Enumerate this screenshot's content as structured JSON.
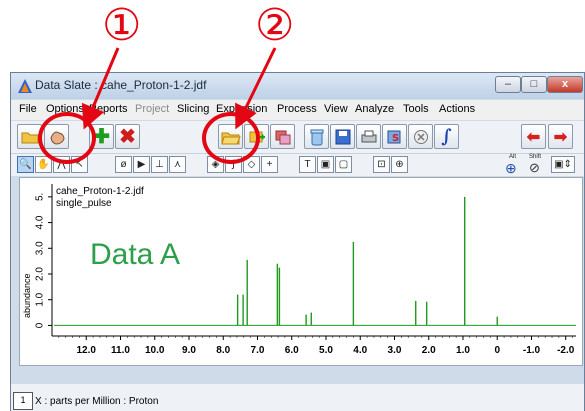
{
  "callouts": [
    {
      "num": "①"
    },
    {
      "num": "②"
    }
  ],
  "window": {
    "title": "Data Slate : cahe_Proton-1-2.jdf",
    "close_glyph": "x",
    "min_glyph": "–",
    "max_glyph": "□"
  },
  "menu": [
    "File",
    "Options",
    "Reports",
    "Project",
    "Slicing",
    "Expansion",
    "Process",
    "View",
    "Analyze",
    "Tools",
    "Actions"
  ],
  "toolbar2": {
    "alt_label": "Alt",
    "shift_label": "Shift"
  },
  "plot": {
    "filename": "cahe_Proton-1-2.jdf",
    "pulse": "single_pulse",
    "overlay_label": "Data A",
    "overlay_color": "#2ca048",
    "trace_color": "#1f9a1f"
  },
  "chart_data": {
    "type": "line",
    "title": "",
    "xlabel": "X : parts per Million : Proton",
    "ylabel": "abundance",
    "xlim": [
      13.0,
      -2.3
    ],
    "ylim": [
      -0.1,
      5.5
    ],
    "x_ticks": [
      "12.0",
      "11.0",
      "10.0",
      "9.0",
      "8.0",
      "7.0",
      "6.0",
      "5.0",
      "4.0",
      "3.0",
      "2.0",
      "1.0",
      "0",
      "-1.0",
      "-2.0"
    ],
    "y_ticks": [
      "0",
      "1.0",
      "2.0",
      "3.0",
      "4.0",
      "5."
    ],
    "peaks": [
      {
        "x": 7.58,
        "y": 1.2
      },
      {
        "x": 7.42,
        "y": 1.2
      },
      {
        "x": 7.3,
        "y": 2.55
      },
      {
        "x": 6.42,
        "y": 2.4
      },
      {
        "x": 6.36,
        "y": 2.25
      },
      {
        "x": 5.58,
        "y": 0.42
      },
      {
        "x": 5.43,
        "y": 0.5
      },
      {
        "x": 4.2,
        "y": 3.25
      },
      {
        "x": 2.38,
        "y": 0.95
      },
      {
        "x": 2.06,
        "y": 0.92
      },
      {
        "x": 0.95,
        "y": 5.0
      },
      {
        "x": 0.0,
        "y": 0.34
      }
    ]
  },
  "statusbar": {
    "badge": "1",
    "text": "X : parts per Million : Proton"
  }
}
